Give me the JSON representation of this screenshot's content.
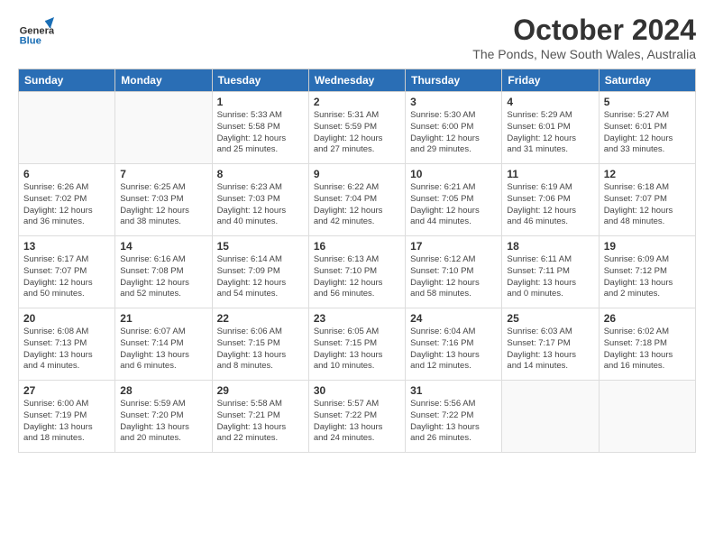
{
  "header": {
    "logo_general": "General",
    "logo_blue": "Blue",
    "month": "October 2024",
    "location": "The Ponds, New South Wales, Australia"
  },
  "weekdays": [
    "Sunday",
    "Monday",
    "Tuesday",
    "Wednesday",
    "Thursday",
    "Friday",
    "Saturday"
  ],
  "weeks": [
    [
      {
        "day": "",
        "info": ""
      },
      {
        "day": "",
        "info": ""
      },
      {
        "day": "1",
        "info": "Sunrise: 5:33 AM\nSunset: 5:58 PM\nDaylight: 12 hours\nand 25 minutes."
      },
      {
        "day": "2",
        "info": "Sunrise: 5:31 AM\nSunset: 5:59 PM\nDaylight: 12 hours\nand 27 minutes."
      },
      {
        "day": "3",
        "info": "Sunrise: 5:30 AM\nSunset: 6:00 PM\nDaylight: 12 hours\nand 29 minutes."
      },
      {
        "day": "4",
        "info": "Sunrise: 5:29 AM\nSunset: 6:01 PM\nDaylight: 12 hours\nand 31 minutes."
      },
      {
        "day": "5",
        "info": "Sunrise: 5:27 AM\nSunset: 6:01 PM\nDaylight: 12 hours\nand 33 minutes."
      }
    ],
    [
      {
        "day": "6",
        "info": "Sunrise: 6:26 AM\nSunset: 7:02 PM\nDaylight: 12 hours\nand 36 minutes."
      },
      {
        "day": "7",
        "info": "Sunrise: 6:25 AM\nSunset: 7:03 PM\nDaylight: 12 hours\nand 38 minutes."
      },
      {
        "day": "8",
        "info": "Sunrise: 6:23 AM\nSunset: 7:03 PM\nDaylight: 12 hours\nand 40 minutes."
      },
      {
        "day": "9",
        "info": "Sunrise: 6:22 AM\nSunset: 7:04 PM\nDaylight: 12 hours\nand 42 minutes."
      },
      {
        "day": "10",
        "info": "Sunrise: 6:21 AM\nSunset: 7:05 PM\nDaylight: 12 hours\nand 44 minutes."
      },
      {
        "day": "11",
        "info": "Sunrise: 6:19 AM\nSunset: 7:06 PM\nDaylight: 12 hours\nand 46 minutes."
      },
      {
        "day": "12",
        "info": "Sunrise: 6:18 AM\nSunset: 7:07 PM\nDaylight: 12 hours\nand 48 minutes."
      }
    ],
    [
      {
        "day": "13",
        "info": "Sunrise: 6:17 AM\nSunset: 7:07 PM\nDaylight: 12 hours\nand 50 minutes."
      },
      {
        "day": "14",
        "info": "Sunrise: 6:16 AM\nSunset: 7:08 PM\nDaylight: 12 hours\nand 52 minutes."
      },
      {
        "day": "15",
        "info": "Sunrise: 6:14 AM\nSunset: 7:09 PM\nDaylight: 12 hours\nand 54 minutes."
      },
      {
        "day": "16",
        "info": "Sunrise: 6:13 AM\nSunset: 7:10 PM\nDaylight: 12 hours\nand 56 minutes."
      },
      {
        "day": "17",
        "info": "Sunrise: 6:12 AM\nSunset: 7:10 PM\nDaylight: 12 hours\nand 58 minutes."
      },
      {
        "day": "18",
        "info": "Sunrise: 6:11 AM\nSunset: 7:11 PM\nDaylight: 13 hours\nand 0 minutes."
      },
      {
        "day": "19",
        "info": "Sunrise: 6:09 AM\nSunset: 7:12 PM\nDaylight: 13 hours\nand 2 minutes."
      }
    ],
    [
      {
        "day": "20",
        "info": "Sunrise: 6:08 AM\nSunset: 7:13 PM\nDaylight: 13 hours\nand 4 minutes."
      },
      {
        "day": "21",
        "info": "Sunrise: 6:07 AM\nSunset: 7:14 PM\nDaylight: 13 hours\nand 6 minutes."
      },
      {
        "day": "22",
        "info": "Sunrise: 6:06 AM\nSunset: 7:15 PM\nDaylight: 13 hours\nand 8 minutes."
      },
      {
        "day": "23",
        "info": "Sunrise: 6:05 AM\nSunset: 7:15 PM\nDaylight: 13 hours\nand 10 minutes."
      },
      {
        "day": "24",
        "info": "Sunrise: 6:04 AM\nSunset: 7:16 PM\nDaylight: 13 hours\nand 12 minutes."
      },
      {
        "day": "25",
        "info": "Sunrise: 6:03 AM\nSunset: 7:17 PM\nDaylight: 13 hours\nand 14 minutes."
      },
      {
        "day": "26",
        "info": "Sunrise: 6:02 AM\nSunset: 7:18 PM\nDaylight: 13 hours\nand 16 minutes."
      }
    ],
    [
      {
        "day": "27",
        "info": "Sunrise: 6:00 AM\nSunset: 7:19 PM\nDaylight: 13 hours\nand 18 minutes."
      },
      {
        "day": "28",
        "info": "Sunrise: 5:59 AM\nSunset: 7:20 PM\nDaylight: 13 hours\nand 20 minutes."
      },
      {
        "day": "29",
        "info": "Sunrise: 5:58 AM\nSunset: 7:21 PM\nDaylight: 13 hours\nand 22 minutes."
      },
      {
        "day": "30",
        "info": "Sunrise: 5:57 AM\nSunset: 7:22 PM\nDaylight: 13 hours\nand 24 minutes."
      },
      {
        "day": "31",
        "info": "Sunrise: 5:56 AM\nSunset: 7:22 PM\nDaylight: 13 hours\nand 26 minutes."
      },
      {
        "day": "",
        "info": ""
      },
      {
        "day": "",
        "info": ""
      }
    ]
  ]
}
